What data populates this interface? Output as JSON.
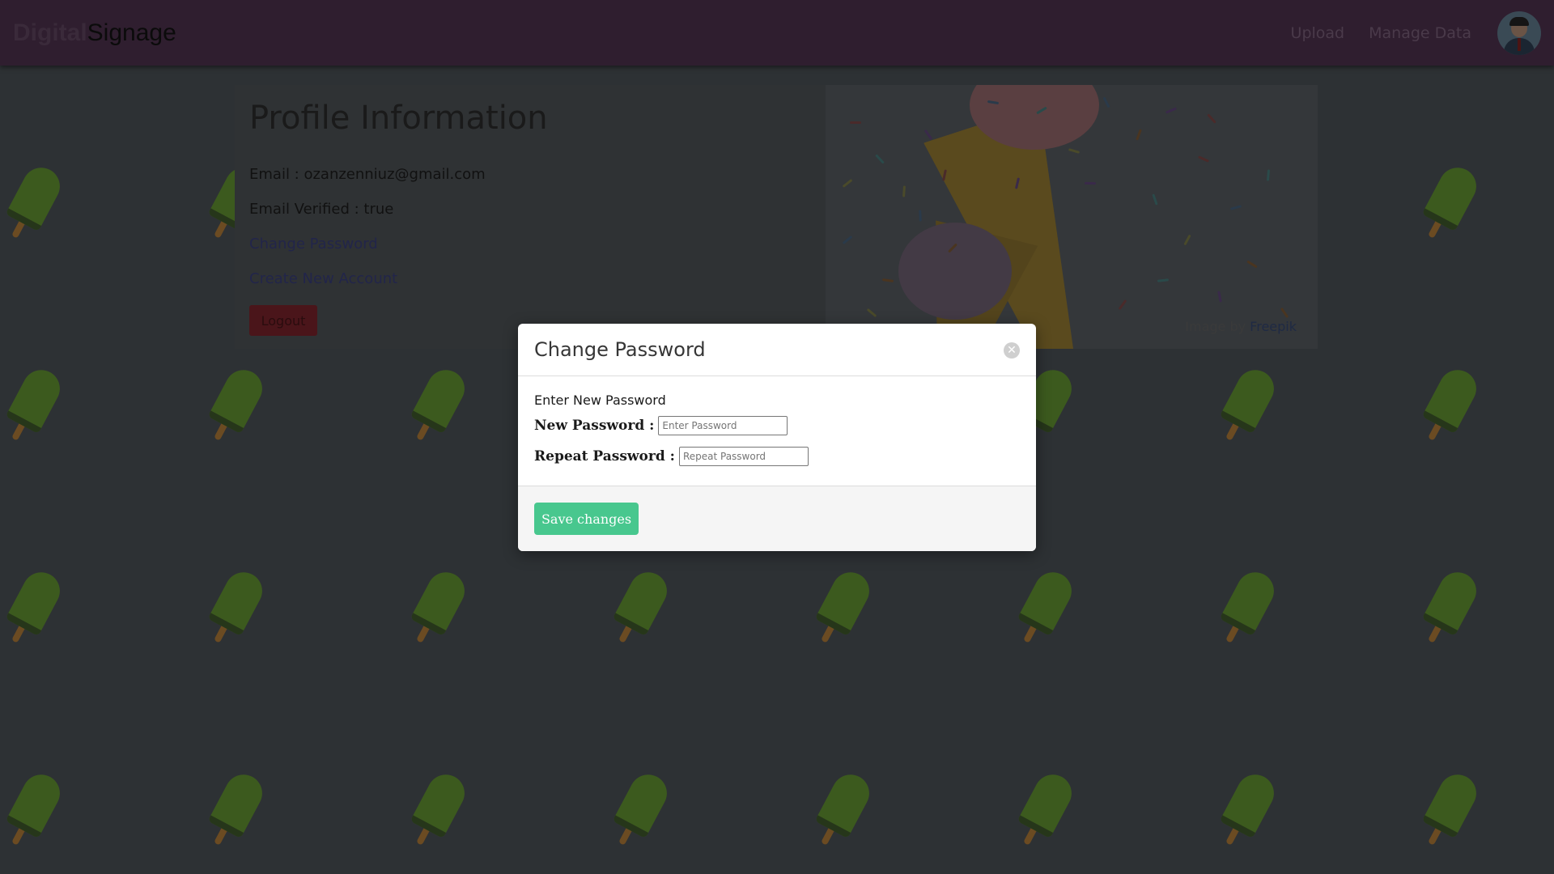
{
  "navbar": {
    "brand_part1": "Digital",
    "brand_part2": "Signage",
    "links": [
      "Upload",
      "Manage Data"
    ],
    "avatar_icon": "user-avatar-icon"
  },
  "profile": {
    "title": "Profile Information",
    "email_line": "Email : ozanzenniuz@gmail.com",
    "verified_line": "Email Verified : true",
    "change_password_link": "Change Password",
    "create_account_link": "Create New Account",
    "logout_label": "Logout",
    "image_credit_prefix": "Image by ",
    "image_credit_link": "Freepik"
  },
  "modal": {
    "title": "Change Password",
    "close_icon": "close-icon",
    "heading": "Enter New Password",
    "new_password_label": "New Password :",
    "new_password_placeholder": "Enter Password",
    "repeat_password_label": "Repeat Password :",
    "repeat_password_placeholder": "Repeat Password",
    "save_label": "Save changes"
  },
  "colors": {
    "navbar_bg": "#2f1e2f",
    "overlay_bg": "#2d3134",
    "save_button": "#48c78e",
    "logout_button": "#4a151a"
  }
}
